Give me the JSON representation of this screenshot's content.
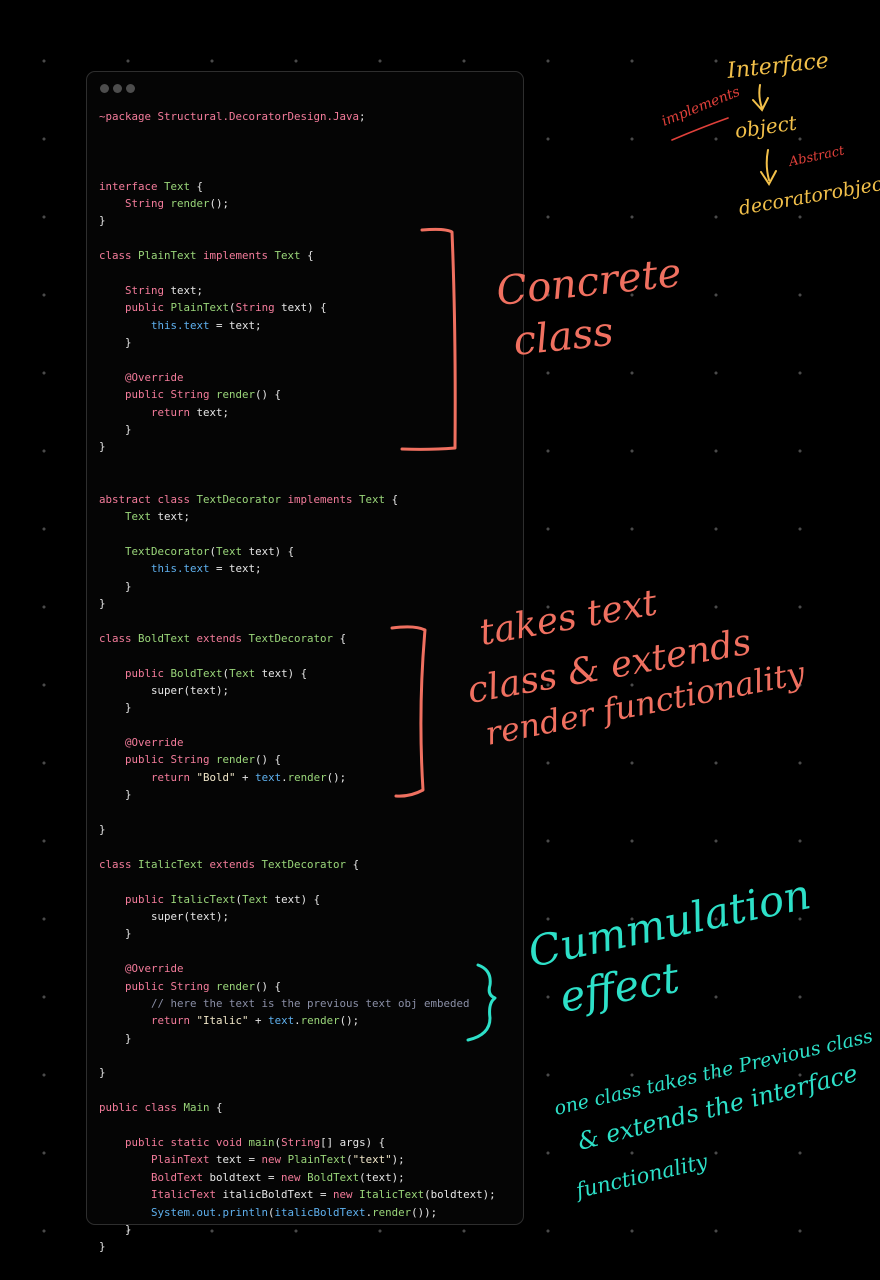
{
  "colors": {
    "background": "#000000",
    "keyword": "#f47c9b",
    "type": "#9ad67a",
    "this": "#5fb1ef",
    "comment": "#8a8fa6",
    "ink_salmon": "#f07060",
    "ink_yellow": "#f2c04a",
    "ink_red": "#e0403a",
    "ink_teal": "#2de0c8"
  },
  "code_window": {
    "window_controls": [
      "close-dot",
      "minimize-dot",
      "maximize-dot"
    ],
    "lines": [
      [
        [
          "pkg",
          "~package Structural.DecoratorDesign.Java"
        ],
        [
          "pl",
          ";"
        ]
      ],
      [],
      [],
      [],
      [
        [
          "kw",
          "interface "
        ],
        [
          "type",
          "Text"
        ],
        [
          "pl",
          " {"
        ]
      ],
      [
        [
          "pl",
          "    "
        ],
        [
          "kw",
          "String "
        ],
        [
          "fn",
          "render"
        ],
        [
          "pl",
          "();"
        ]
      ],
      [
        [
          "pl",
          "}"
        ]
      ],
      [],
      [
        [
          "kw",
          "class "
        ],
        [
          "type",
          "PlainText "
        ],
        [
          "kw",
          "implements "
        ],
        [
          "type",
          "Text"
        ],
        [
          "pl",
          " {"
        ]
      ],
      [],
      [
        [
          "pl",
          "    "
        ],
        [
          "kw",
          "String "
        ],
        [
          "pl",
          "text;"
        ]
      ],
      [
        [
          "pl",
          "    "
        ],
        [
          "kw",
          "public "
        ],
        [
          "fn",
          "PlainText"
        ],
        [
          "pl",
          "("
        ],
        [
          "kw",
          "String "
        ],
        [
          "pl",
          "text) {"
        ]
      ],
      [
        [
          "pl",
          "        "
        ],
        [
          "this",
          "this.text"
        ],
        [
          "pl",
          " = text;"
        ]
      ],
      [
        [
          "pl",
          "    }"
        ]
      ],
      [],
      [
        [
          "pl",
          "    "
        ],
        [
          "ann",
          "@Override"
        ]
      ],
      [
        [
          "pl",
          "    "
        ],
        [
          "kw",
          "public String "
        ],
        [
          "fn",
          "render"
        ],
        [
          "pl",
          "() {"
        ]
      ],
      [
        [
          "pl",
          "        "
        ],
        [
          "kw",
          "return "
        ],
        [
          "pl",
          "text;"
        ]
      ],
      [
        [
          "pl",
          "    }"
        ]
      ],
      [
        [
          "pl",
          "}"
        ]
      ],
      [],
      [],
      [
        [
          "kw",
          "abstract class "
        ],
        [
          "type",
          "TextDecorator "
        ],
        [
          "kw",
          "implements "
        ],
        [
          "type",
          "Text"
        ],
        [
          "pl",
          " {"
        ]
      ],
      [
        [
          "pl",
          "    "
        ],
        [
          "type",
          "Text "
        ],
        [
          "pl",
          "text;"
        ]
      ],
      [],
      [
        [
          "pl",
          "    "
        ],
        [
          "fn",
          "TextDecorator"
        ],
        [
          "pl",
          "("
        ],
        [
          "type",
          "Text "
        ],
        [
          "pl",
          "text) {"
        ]
      ],
      [
        [
          "pl",
          "        "
        ],
        [
          "this",
          "this.text"
        ],
        [
          "pl",
          " = text;"
        ]
      ],
      [
        [
          "pl",
          "    }"
        ]
      ],
      [
        [
          "pl",
          "}"
        ]
      ],
      [],
      [
        [
          "kw",
          "class "
        ],
        [
          "type",
          "BoldText "
        ],
        [
          "kw",
          "extends "
        ],
        [
          "type",
          "TextDecorator"
        ],
        [
          "pl",
          " {"
        ]
      ],
      [],
      [
        [
          "pl",
          "    "
        ],
        [
          "kw",
          "public "
        ],
        [
          "fn",
          "BoldText"
        ],
        [
          "pl",
          "("
        ],
        [
          "type",
          "Text "
        ],
        [
          "pl",
          "text) {"
        ]
      ],
      [
        [
          "pl",
          "        super(text);"
        ]
      ],
      [
        [
          "pl",
          "    }"
        ]
      ],
      [],
      [
        [
          "pl",
          "    "
        ],
        [
          "ann",
          "@Override"
        ]
      ],
      [
        [
          "pl",
          "    "
        ],
        [
          "kw",
          "public String "
        ],
        [
          "fn",
          "render"
        ],
        [
          "pl",
          "() {"
        ]
      ],
      [
        [
          "pl",
          "        "
        ],
        [
          "kw",
          "return "
        ],
        [
          "str",
          "\"Bold\""
        ],
        [
          "pl",
          " + "
        ],
        [
          "this",
          "text"
        ],
        [
          "pl",
          "."
        ],
        [
          "fn",
          "render"
        ],
        [
          "pl",
          "();"
        ]
      ],
      [
        [
          "pl",
          "    }"
        ]
      ],
      [],
      [
        [
          "pl",
          "}"
        ]
      ],
      [],
      [
        [
          "kw",
          "class "
        ],
        [
          "type",
          "ItalicText "
        ],
        [
          "kw",
          "extends "
        ],
        [
          "type",
          "TextDecorator"
        ],
        [
          "pl",
          " {"
        ]
      ],
      [],
      [
        [
          "pl",
          "    "
        ],
        [
          "kw",
          "public "
        ],
        [
          "fn",
          "ItalicText"
        ],
        [
          "pl",
          "("
        ],
        [
          "type",
          "Text "
        ],
        [
          "pl",
          "text) {"
        ]
      ],
      [
        [
          "pl",
          "        super(text);"
        ]
      ],
      [
        [
          "pl",
          "    }"
        ]
      ],
      [],
      [
        [
          "pl",
          "    "
        ],
        [
          "ann",
          "@Override"
        ]
      ],
      [
        [
          "pl",
          "    "
        ],
        [
          "kw",
          "public String "
        ],
        [
          "fn",
          "render"
        ],
        [
          "pl",
          "() {"
        ]
      ],
      [
        [
          "pl",
          "        "
        ],
        [
          "cm",
          "// here the text is the previous text obj embeded"
        ]
      ],
      [
        [
          "pl",
          "        "
        ],
        [
          "kw",
          "return "
        ],
        [
          "str",
          "\"Italic\""
        ],
        [
          "pl",
          " + "
        ],
        [
          "this",
          "text"
        ],
        [
          "pl",
          "."
        ],
        [
          "fn",
          "render"
        ],
        [
          "pl",
          "();"
        ]
      ],
      [
        [
          "pl",
          "    }"
        ]
      ],
      [],
      [
        [
          "pl",
          "}"
        ]
      ],
      [],
      [
        [
          "kw",
          "public class "
        ],
        [
          "type",
          "Main"
        ],
        [
          "pl",
          " {"
        ]
      ],
      [],
      [
        [
          "pl",
          "    "
        ],
        [
          "kw",
          "public static void "
        ],
        [
          "fn",
          "main"
        ],
        [
          "pl",
          "("
        ],
        [
          "kw",
          "String"
        ],
        [
          "pl",
          "[] args) {"
        ]
      ],
      [
        [
          "pl",
          "        "
        ],
        [
          "kw",
          "PlainText "
        ],
        [
          "pl",
          "text = "
        ],
        [
          "kw",
          "new "
        ],
        [
          "fn",
          "PlainText"
        ],
        [
          "pl",
          "("
        ],
        [
          "str",
          "\"text\""
        ],
        [
          "pl",
          ");"
        ]
      ],
      [
        [
          "pl",
          "        "
        ],
        [
          "kw",
          "BoldText "
        ],
        [
          "pl",
          "boldtext = "
        ],
        [
          "kw",
          "new "
        ],
        [
          "fn",
          "BoldText"
        ],
        [
          "pl",
          "(text);"
        ]
      ],
      [
        [
          "pl",
          "        "
        ],
        [
          "kw",
          "ItalicText "
        ],
        [
          "pl",
          "italicBoldText = "
        ],
        [
          "kw",
          "new "
        ],
        [
          "fn",
          "ItalicText"
        ],
        [
          "pl",
          "(boldtext);"
        ]
      ],
      [
        [
          "pl",
          "        "
        ],
        [
          "sys",
          "System.out.println"
        ],
        [
          "pl",
          "("
        ],
        [
          "this",
          "italicBoldText"
        ],
        [
          "pl",
          "."
        ],
        [
          "fn",
          "render"
        ],
        [
          "pl",
          "());"
        ]
      ],
      [
        [
          "pl",
          "    }"
        ]
      ],
      [
        [
          "pl",
          "}"
        ]
      ]
    ]
  },
  "annotations": {
    "concrete_line1": "Concrete",
    "concrete_line2": "class",
    "takes_line1": "takes text",
    "takes_line2": "class & extends",
    "takes_line3": "render functionality",
    "cumm_line1": "Cummulation",
    "cumm_line2": "effect",
    "note_line1": "one class takes the Previous class",
    "note_line2": "& extends the interface",
    "note_line3": "functionality",
    "flow_interface": "Interface",
    "flow_object": "object",
    "flow_decorator": "decoratorobject",
    "flow_implements": "implements",
    "flow_abstract": "Abstract"
  }
}
